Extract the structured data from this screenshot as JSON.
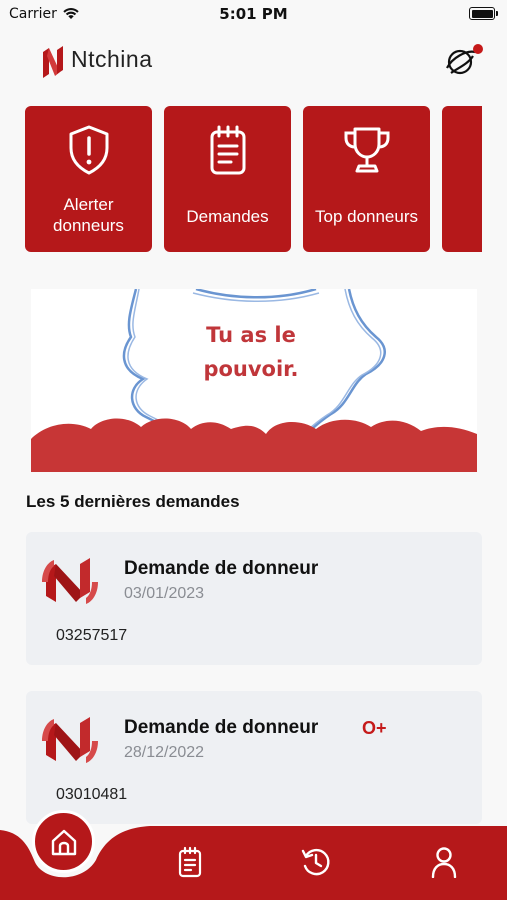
{
  "status_bar": {
    "carrier": "Carrier",
    "time": "5:01 PM"
  },
  "header": {
    "app_name": "Ntchina"
  },
  "tiles": [
    {
      "label_line1": "Alerter",
      "label_line2": "donneurs",
      "icon": "alert-shield-icon"
    },
    {
      "label_line1": "Demandes",
      "icon": "notepad-icon"
    },
    {
      "label_line1": "Top donneurs",
      "icon": "trophy-icon"
    }
  ],
  "banner": {
    "line1": "Tu as le",
    "line2": "pouvoir."
  },
  "section_title": "Les 5 dernières demandes",
  "requests": [
    {
      "title": "Demande de donneur",
      "date": "03/01/2023",
      "phone": "03257517",
      "blood_type": ""
    },
    {
      "title": "Demande de donneur",
      "date": "28/12/2022",
      "phone": "03010481",
      "blood_type": "O+"
    }
  ],
  "tabbar": {
    "tabs": [
      "home-icon",
      "notepad-icon",
      "history-icon",
      "user-icon"
    ]
  },
  "colors": {
    "brand_red": "#b5181a",
    "card_bg": "#eef0f3",
    "date_gray": "#8a8d93"
  }
}
